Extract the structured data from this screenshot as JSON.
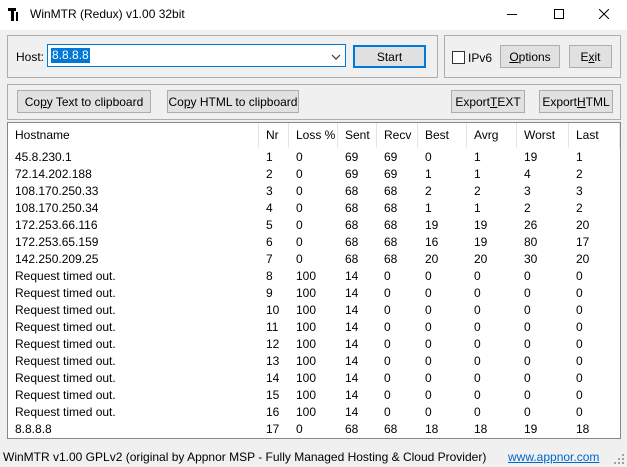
{
  "window": {
    "title": "WinMTR (Redux) v1.00 32bit",
    "min_icon": "minimize-icon",
    "max_icon": "maximize-icon",
    "close_icon": "close-icon"
  },
  "host": {
    "label": "Host:",
    "value": "8.8.8.8",
    "start_label": "Start"
  },
  "options": {
    "ipv6_label": "IPv6",
    "ipv6_checked": false,
    "options_label": "Options",
    "exit_label": "Exit"
  },
  "export": {
    "copy_text_label": "Copy Text to clipboard",
    "copy_html_label": "Copy HTML to clipboard",
    "export_text_label": "Export TEXT",
    "export_html_label": "Export HTML"
  },
  "table": {
    "columns": [
      "Hostname",
      "Nr",
      "Loss %",
      "Sent",
      "Recv",
      "Best",
      "Avrg",
      "Worst",
      "Last"
    ],
    "rows": [
      [
        "45.8.230.1",
        "1",
        "0",
        "69",
        "69",
        "0",
        "1",
        "19",
        "1"
      ],
      [
        "72.14.202.188",
        "2",
        "0",
        "69",
        "69",
        "1",
        "1",
        "4",
        "2"
      ],
      [
        "108.170.250.33",
        "3",
        "0",
        "68",
        "68",
        "2",
        "2",
        "3",
        "3"
      ],
      [
        "108.170.250.34",
        "4",
        "0",
        "68",
        "68",
        "1",
        "1",
        "2",
        "2"
      ],
      [
        "172.253.66.116",
        "5",
        "0",
        "68",
        "68",
        "19",
        "19",
        "26",
        "20"
      ],
      [
        "172.253.65.159",
        "6",
        "0",
        "68",
        "68",
        "16",
        "19",
        "80",
        "17"
      ],
      [
        "142.250.209.25",
        "7",
        "0",
        "68",
        "68",
        "20",
        "20",
        "30",
        "20"
      ],
      [
        "Request timed out.",
        "8",
        "100",
        "14",
        "0",
        "0",
        "0",
        "0",
        "0"
      ],
      [
        "Request timed out.",
        "9",
        "100",
        "14",
        "0",
        "0",
        "0",
        "0",
        "0"
      ],
      [
        "Request timed out.",
        "10",
        "100",
        "14",
        "0",
        "0",
        "0",
        "0",
        "0"
      ],
      [
        "Request timed out.",
        "11",
        "100",
        "14",
        "0",
        "0",
        "0",
        "0",
        "0"
      ],
      [
        "Request timed out.",
        "12",
        "100",
        "14",
        "0",
        "0",
        "0",
        "0",
        "0"
      ],
      [
        "Request timed out.",
        "13",
        "100",
        "14",
        "0",
        "0",
        "0",
        "0",
        "0"
      ],
      [
        "Request timed out.",
        "14",
        "100",
        "14",
        "0",
        "0",
        "0",
        "0",
        "0"
      ],
      [
        "Request timed out.",
        "15",
        "100",
        "14",
        "0",
        "0",
        "0",
        "0",
        "0"
      ],
      [
        "Request timed out.",
        "16",
        "100",
        "14",
        "0",
        "0",
        "0",
        "0",
        "0"
      ],
      [
        "8.8.8.8",
        "17",
        "0",
        "68",
        "68",
        "18",
        "18",
        "19",
        "18"
      ]
    ]
  },
  "status": {
    "text": "WinMTR v1.00 GPLv2 (original by Appnor MSP - Fully Managed Hosting & Cloud Provider)",
    "link": "www.appnor.com"
  },
  "colors": {
    "accent": "#0078d7",
    "link": "#0066cc",
    "button_face": "#e1e1e1",
    "window_bg": "#f0f0f0"
  }
}
